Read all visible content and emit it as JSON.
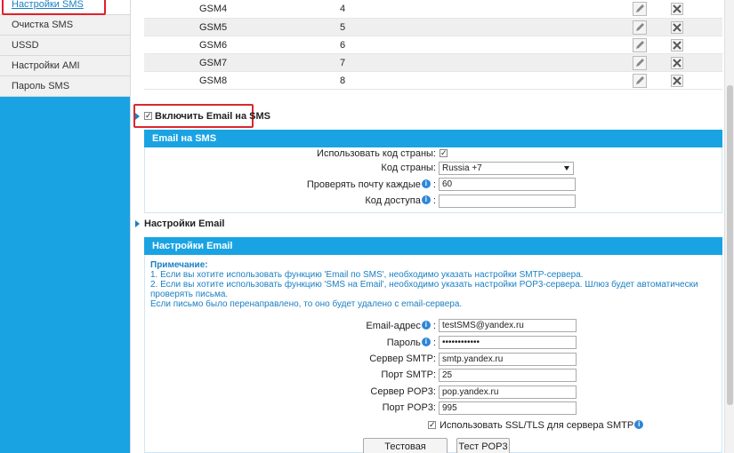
{
  "sidebar": {
    "items": [
      {
        "label": "Настройки SMS",
        "active": true
      },
      {
        "label": "Очистка SMS"
      },
      {
        "label": "USSD"
      },
      {
        "label": "Настройки AMI"
      },
      {
        "label": "Пароль SMS"
      }
    ]
  },
  "gsm_table": {
    "rows": [
      {
        "name": "GSM4",
        "number": "4"
      },
      {
        "name": "GSM5",
        "number": "5"
      },
      {
        "name": "GSM6",
        "number": "6"
      },
      {
        "name": "GSM7",
        "number": "7"
      },
      {
        "name": "GSM8",
        "number": "8"
      }
    ]
  },
  "enable_email_sms": {
    "label": "Включить Email на SMS",
    "checked": true
  },
  "email_sms_section": {
    "title": "Email на SMS",
    "use_country_code_label": "Использовать код страны:",
    "use_country_code_checked": true,
    "country_code_label": "Код страны:",
    "country_code_value": "Russia +7",
    "check_mail_label": "Проверять почту каждые",
    "check_mail_value": "60",
    "access_code_label": "Код доступа",
    "access_code_value": ""
  },
  "email_settings_toggle": {
    "label": "Настройки Email"
  },
  "email_settings_section": {
    "title": "Настройки Email",
    "note_title": "Примечание:",
    "note_lines": [
      "1. Если вы хотите использовать функцию 'Email по SMS', необходимо указать настройки SMTP-сервера.",
      "2. Если вы хотите использовать функцию 'SMS на Email', необходимо указать настройки POP3-сервера. Шлюз будет автоматически проверять письма.",
      "Если письмо было перенаправлено, то оно будет удалено с email-сервера."
    ],
    "email_label": "Email-адрес",
    "email_value": "testSMS@yandex.ru",
    "password_label": "Пароль",
    "password_value": "••••••••••••",
    "smtp_server_label": "Сервер SMTP:",
    "smtp_server_value": "smtp.yandex.ru",
    "smtp_port_label": "Порт SMTP:",
    "smtp_port_value": "25",
    "pop3_server_label": "Сервер POP3:",
    "pop3_server_value": "pop.yandex.ru",
    "pop3_port_label": "Порт POP3:",
    "pop3_port_value": "995",
    "ssl_label": "Использовать SSL/TLS для сервера SMTP",
    "ssl_checked": true,
    "test_send_label": "Тестовая отправка",
    "test_pop3_label": "Тест POP3"
  },
  "icons": {
    "edit": "pencil-icon",
    "delete": "x-icon",
    "info": "info-icon",
    "arrow": "triangle-right-icon"
  },
  "colors": {
    "accent": "#1aa3e3",
    "highlight": "#d9282f",
    "link": "#1a7fc1"
  }
}
